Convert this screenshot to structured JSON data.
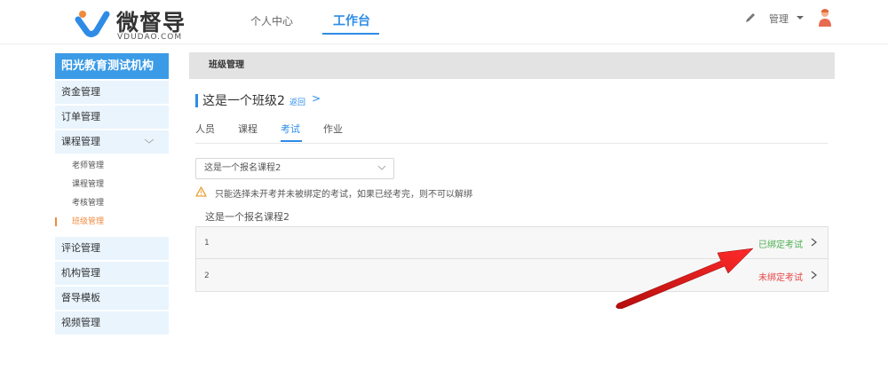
{
  "header": {
    "logo_text": "微督导",
    "logo_sub": "VDUDAO.COM",
    "nav": [
      {
        "label": "个人中心"
      },
      {
        "label": "工作台"
      }
    ],
    "user_label": "管理",
    "icons": {
      "edit": "pencil-icon",
      "dropdown": "caret-down-icon",
      "avatar": "user-avatar-icon"
    }
  },
  "sidebar": {
    "org_title": "阳光教育测试机构",
    "items_top": [
      {
        "label": "资金管理"
      },
      {
        "label": "订单管理"
      },
      {
        "label": "课程管理"
      }
    ],
    "course_sub": [
      {
        "label": "老师管理"
      },
      {
        "label": "课程管理"
      },
      {
        "label": "考核管理"
      },
      {
        "label": "班级管理"
      }
    ],
    "items_bottom": [
      {
        "label": "评论管理"
      },
      {
        "label": "机构管理"
      },
      {
        "label": "督导模板"
      },
      {
        "label": "视频管理"
      }
    ]
  },
  "main": {
    "breadcrumb": "班级管理",
    "class_title": "这是一个班级2",
    "back_label": "返回",
    "back_chevron": ">",
    "tabs": [
      {
        "label": "人员"
      },
      {
        "label": "课程"
      },
      {
        "label": "考试"
      },
      {
        "label": "作业"
      }
    ],
    "select_value": "这是一个报名课程2",
    "warning": "只能选择未开考并未被绑定的考试，如果已经考完，则不可以解绑",
    "course_name": "这是一个报名课程2",
    "rows": [
      {
        "num": "1",
        "status": "已绑定考试"
      },
      {
        "num": "2",
        "status": "未绑定考试"
      }
    ]
  },
  "colors": {
    "accent": "#2e8ce6",
    "active_sub": "#f08a3c",
    "bound": "#4caf50",
    "unbound": "#e64545",
    "annotation_arrow": "#e01a1a"
  }
}
